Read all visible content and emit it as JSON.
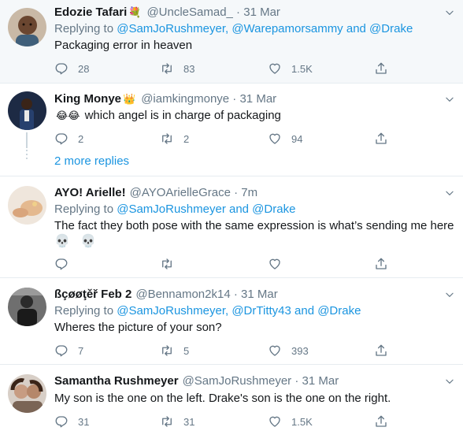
{
  "tweets": [
    {
      "name": "Edozie Tafari",
      "badge": "💐",
      "handle": "@UncleSamad_",
      "time": "31 Mar",
      "replying_label": "Replying to",
      "mentions": "@SamJoRushmeyer, @Warepamorsammy and @Drake",
      "text": "Packaging error in heaven",
      "replies": "28",
      "retweets": "83",
      "likes": "1.5K"
    },
    {
      "name": "King Monye",
      "badge": "👑",
      "handle": "@iamkingmonye",
      "time": "31 Mar",
      "text_emoji": "😂😂",
      "text": "which angel is in charge of packaging",
      "replies": "2",
      "retweets": "2",
      "likes": "94"
    },
    {
      "name": "AYO! Arielle!",
      "handle": "@AYOArielleGrace",
      "time": "7m",
      "replying_label": "Replying to",
      "mentions": "@SamJoRushmeyer and @Drake",
      "text": "The fact they both pose with the same expression is what’s sending me here",
      "text2": "💀 💀",
      "replies": "",
      "retweets": "",
      "likes": ""
    },
    {
      "name": "ßçøøţěř Feb 2",
      "handle": "@Bennamon2k14",
      "time": "31 Mar",
      "replying_label": "Replying to",
      "mentions": "@SamJoRushmeyer, @DrTitty43 and @Drake",
      "text": "Wheres the picture of your son?",
      "replies": "7",
      "retweets": "5",
      "likes": "393"
    },
    {
      "name": "Samantha Rushmeyer",
      "handle": "@SamJoRushmeyer",
      "time": "31 Mar",
      "text": "My son is the one on the left. Drake's son is the one on the right.",
      "replies": "31",
      "retweets": "31",
      "likes": "1.5K"
    }
  ],
  "more_replies": "2 more replies",
  "colors": {
    "link": "#1b95e0",
    "muted": "#657786",
    "border": "#e6ecf0",
    "highlight_bg": "#f5f8fa"
  },
  "icons": [
    "reply-icon",
    "retweet-icon",
    "like-icon",
    "share-icon",
    "chevron-down-icon"
  ]
}
